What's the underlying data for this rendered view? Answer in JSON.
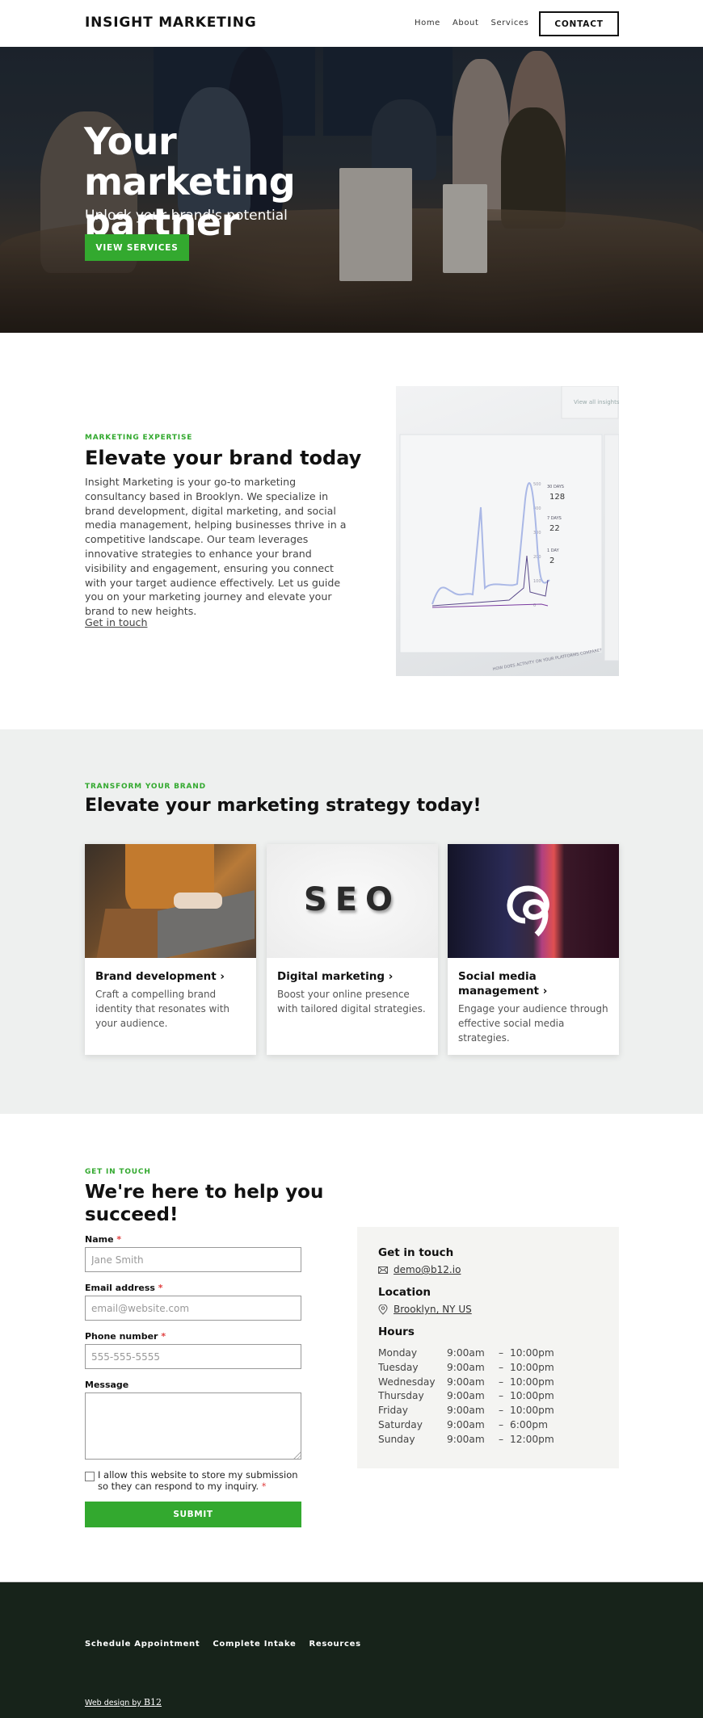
{
  "header": {
    "logo": "INSIGHT MARKETING",
    "nav": [
      "Home",
      "About",
      "Services"
    ],
    "contact_label": "CONTACT"
  },
  "hero": {
    "title": "Your marketing partner",
    "subtitle": "Unlock your brand's potential",
    "button_label": "VIEW SERVICES"
  },
  "about": {
    "eyebrow": "MARKETING EXPERTISE",
    "title": "Elevate your brand today",
    "text": "Insight Marketing is your go-to marketing consultancy based in Brooklyn. We specialize in brand development, digital marketing, and social media management, helping businesses thrive in a competitive landscape. Our team leverages innovative strategies to enhance your brand visibility and engagement, ensuring you connect with your target audience effectively. Let us guide you on your marketing journey and elevate your brand to new heights.",
    "link": "Get in touch",
    "image_readout": {
      "link": "View all insights →",
      "legend": [
        {
          "label": "30 DAYS",
          "value": "128"
        },
        {
          "label": "7 DAYS",
          "value": "22"
        },
        {
          "label": "1 DAY",
          "value": "2"
        }
      ],
      "yticks": [
        "500",
        "400",
        "300",
        "200",
        "100",
        "0"
      ],
      "footer_caption": "HOW DOES ACTIVITY ON YOUR PLATFORMS COMPARE?"
    }
  },
  "services": {
    "eyebrow": "TRANSFORM YOUR BRAND",
    "title": "Elevate your marketing strategy today!",
    "cards": [
      {
        "title": "Brand development",
        "description": "Craft a compelling brand identity that resonates with your audience.",
        "image": "person-laptop"
      },
      {
        "title": "Digital marketing",
        "description": "Boost your online presence with tailored digital strategies.",
        "image_text": "SEO"
      },
      {
        "title": "Social media management",
        "description": "Engage your audience through effective social media strategies.",
        "image": "threads-logo"
      }
    ],
    "chevron": "›"
  },
  "contact": {
    "eyebrow": "GET IN TOUCH",
    "title": "We're here to help you succeed!",
    "form": {
      "name_label": "Name",
      "name_placeholder": "Jane Smith",
      "email_label": "Email address",
      "email_placeholder": "email@website.com",
      "phone_label": "Phone number",
      "phone_placeholder": "555-555-5555",
      "message_label": "Message",
      "required_mark": "*",
      "consent": "I allow this website to store my submission so they can respond to my inquiry.",
      "submit_label": "SUBMIT"
    },
    "info": {
      "touch_heading": "Get in touch",
      "email": "demo@b12.io",
      "location_heading": "Location",
      "location": "Brooklyn, NY US",
      "hours_heading": "Hours",
      "hours": [
        {
          "day": "Monday",
          "open": "9:00am",
          "close": "10:00pm"
        },
        {
          "day": "Tuesday",
          "open": "9:00am",
          "close": "10:00pm"
        },
        {
          "day": "Wednesday",
          "open": "9:00am",
          "close": "10:00pm"
        },
        {
          "day": "Thursday",
          "open": "9:00am",
          "close": "10:00pm"
        },
        {
          "day": "Friday",
          "open": "9:00am",
          "close": "10:00pm"
        },
        {
          "day": "Saturday",
          "open": "9:00am",
          "close": "6:00pm"
        },
        {
          "day": "Sunday",
          "open": "9:00am",
          "close": "12:00pm"
        }
      ],
      "dash": "–"
    }
  },
  "footer": {
    "links": [
      "Schedule Appointment",
      "Complete Intake",
      "Resources"
    ],
    "credit_prefix": "Web design by ",
    "credit_brand": "B12"
  },
  "colors": {
    "accent": "#33a92f",
    "footer_bg": "#17231a",
    "services_bg": "#eef0ef",
    "info_bg": "#f4f4f2"
  }
}
